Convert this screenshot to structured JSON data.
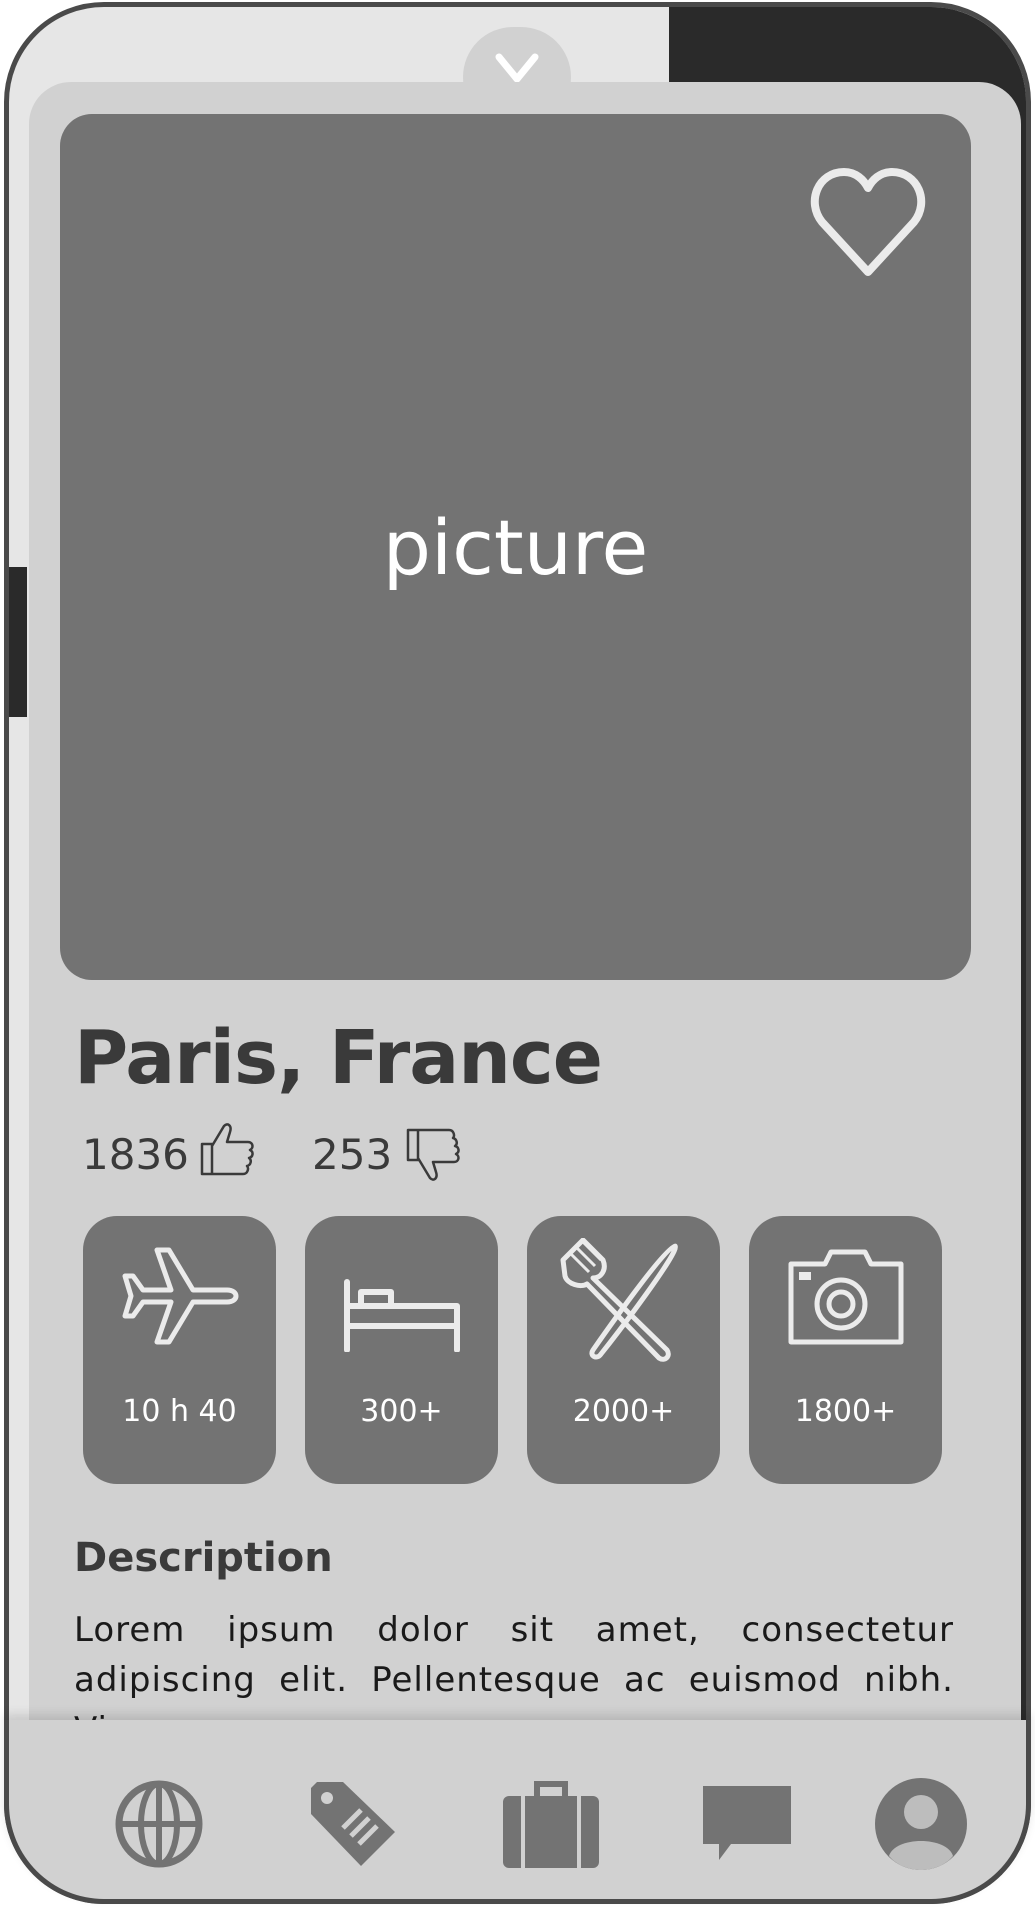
{
  "hero": {
    "placeholder_label": "picture"
  },
  "destination": {
    "title": "Paris, France"
  },
  "votes": {
    "likes": "1836",
    "dislikes": "253"
  },
  "stats": [
    {
      "icon": "airplane-icon",
      "label": "10 h 40"
    },
    {
      "icon": "bed-icon",
      "label": "300+"
    },
    {
      "icon": "cutlery-icon",
      "label": "2000+"
    },
    {
      "icon": "camera-icon",
      "label": "1800+"
    }
  ],
  "description": {
    "heading": "Description",
    "body": "Lorem ipsum dolor sit amet, consectetur adipiscing elit. Pellentesque ac euismod nibh. Vivamus"
  },
  "nav": [
    {
      "icon": "globe-icon"
    },
    {
      "icon": "tag-icon"
    },
    {
      "icon": "briefcase-icon"
    },
    {
      "icon": "chat-icon"
    },
    {
      "icon": "profile-icon"
    }
  ],
  "colors": {
    "panel": "#d1d1d1",
    "tile": "#737373",
    "text": "#3a3a3a"
  }
}
